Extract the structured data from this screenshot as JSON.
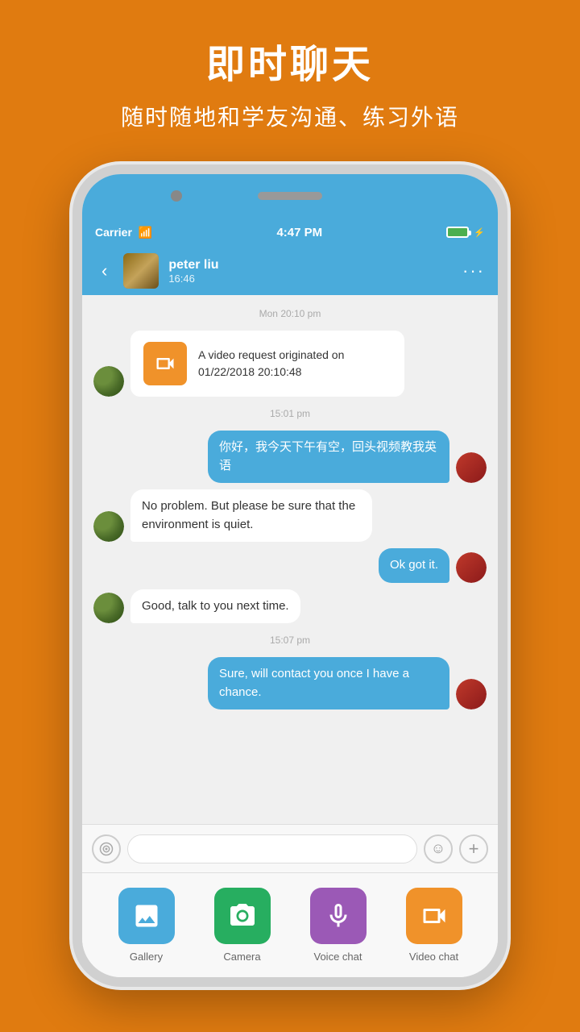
{
  "header": {
    "title": "即时聊天",
    "subtitle": "随时随地和学友沟通、练习外语"
  },
  "status_bar": {
    "carrier": "Carrier",
    "time": "4:47 PM"
  },
  "nav": {
    "contact_name": "peter liu",
    "contact_time": "16:46"
  },
  "chat": {
    "timestamp1": "Mon 20:10 pm",
    "video_request_text": "A video request originated on 01/22/2018 20:10:48",
    "timestamp2": "15:01 pm",
    "msg1": "你好，我今天下午有空，回头视频教我英语",
    "msg2": "No  problem.\nBut  please be sure that the environment is  quiet.",
    "msg3": "Ok got it.",
    "msg4": "Good, talk  to you next time.",
    "timestamp3": "15:07 pm",
    "msg5": "Sure, will contact you once I have a chance."
  },
  "input_bar": {
    "placeholder": ""
  },
  "action_bar": {
    "gallery_label": "Gallery",
    "camera_label": "Camera",
    "voice_label": "Voice chat",
    "video_label": "Video chat"
  }
}
